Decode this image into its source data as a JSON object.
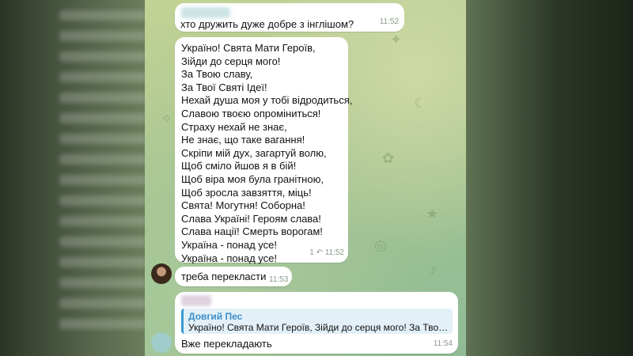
{
  "messages": [
    {
      "text": "хто дружить дуже добре з інглішом?",
      "time": "11:52"
    },
    {
      "lines": [
        "Україно! Свята Мати Героїв,",
        "Зійди до серця мого!",
        "За Твою славу,",
        "За Твої Святі Ідеї!",
        "Нехай душа моя у тобі відродиться,",
        "Славою твоєю опроміниться!",
        "Страху нехай не знає,",
        "Не знає, що таке вагання!",
        "Скріпи мій дух, загартуй волю,",
        "Щоб сміло йшов я в бій!",
        "Щоб віра моя була гранітною,",
        "Щоб зросла завзяття, міць!",
        "Свята! Могутня! Соборна!",
        "Слава Україні! Героям слава!",
        "Слава нації! Смерть ворогам!",
        "Україна - понад усе!",
        "Україна - понад усе!"
      ],
      "forwards": "1",
      "time": "11:52"
    },
    {
      "text": "треба перекласти",
      "time": "11:53"
    },
    {
      "reply_name": "Довгий Пес",
      "reply_text": "Україно! Свята Мати Героїв, Зійди до серця мого! За Твою слав...",
      "text": "Вже перекладають",
      "time": "11:54"
    }
  ],
  "icons": {
    "forward": "reply-arrow-icon"
  }
}
